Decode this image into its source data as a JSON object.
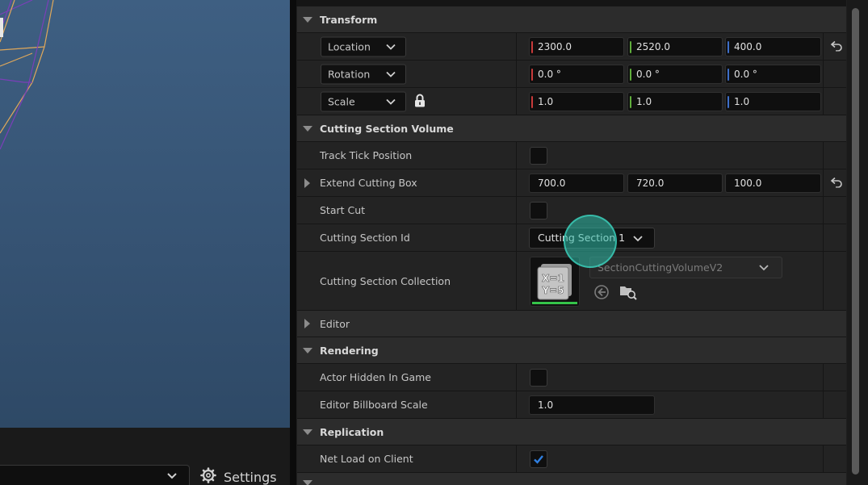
{
  "viewport": {
    "settings_label": "Settings"
  },
  "details": {
    "transform": {
      "title": "Transform",
      "location": {
        "mode": "Location",
        "x": "2300.0",
        "y": "2520.0",
        "z": "400.0"
      },
      "rotation": {
        "mode": "Rotation",
        "x": "0.0 °",
        "y": "0.0 °",
        "z": "0.0 °"
      },
      "scale": {
        "mode": "Scale",
        "x": "1.0",
        "y": "1.0",
        "z": "1.0"
      }
    },
    "cutting_section_volume": {
      "title": "Cutting Section Volume",
      "track_tick_position": {
        "label": "Track Tick Position",
        "checked": false
      },
      "extend_cutting_box": {
        "label": "Extend Cutting Box",
        "x": "700.0",
        "y": "720.0",
        "z": "100.0"
      },
      "start_cut": {
        "label": "Start Cut",
        "checked": false
      },
      "cutting_section_id": {
        "label": "Cutting Section Id",
        "value": "Cutting Section 1"
      },
      "cutting_section_collection": {
        "label": "Cutting Section Collection",
        "asset": "SectionCuttingVolumeV2",
        "thumb_line1": "X=1",
        "thumb_line2": "Y=5"
      }
    },
    "editor": {
      "title": "Editor"
    },
    "rendering": {
      "title": "Rendering",
      "actor_hidden_in_game": {
        "label": "Actor Hidden In Game",
        "checked": false
      },
      "editor_billboard_scale": {
        "label": "Editor Billboard Scale",
        "value": "1.0"
      }
    },
    "replication": {
      "title": "Replication",
      "net_load_on_client": {
        "label": "Net Load on Client",
        "checked": true
      }
    },
    "colors": {
      "x_axis": "#c93a3a",
      "y_axis": "#5fae3c",
      "z_axis": "#3d6fc9",
      "check": "#2f7fe0",
      "asset_underline": "#35c44a"
    }
  }
}
